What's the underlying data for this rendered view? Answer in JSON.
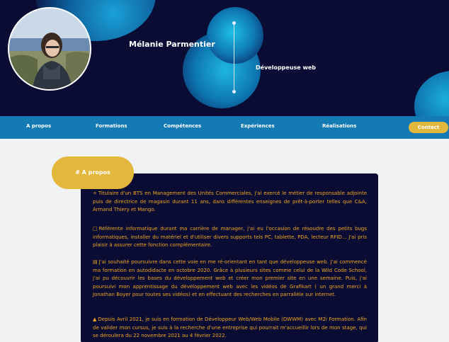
{
  "header": {
    "name": "Mélanie Parmentier",
    "role": "Développeuse web"
  },
  "nav": {
    "items": [
      "A propos",
      "Formations",
      "Compétences",
      "Expériences",
      "Réalisations"
    ],
    "contact": "Contact"
  },
  "about": {
    "heading": "# A propos",
    "paragraphs": [
      {
        "icon": "award-icon",
        "text": "Titulaire d'un BTS en Management des Unités Commerciales, j'ai exercé le métier de responsable adjointe puis de directrice de magasin durant 11 ans, dans différentes enseignes de prêt-à-porter telles que C&A, Armand Thiery et Mango."
      },
      {
        "icon": "laptop-icon",
        "text": "Référente informatique durant ma carrière de manager, j'ai eu l'occasion de résoudre des petits bugs informatiques, installer du matériel et d'utiliser divers supports tels PC, tablette, PDA, lecteur RFID... J'ai pris plaisir à assurer cette fonction complémentaire."
      },
      {
        "icon": "book-icon",
        "text": "J'ai souhaité poursuivre dans cette voie en me ré-orientant en tant que développeuse web. J'ai commencé ma formation en autodidacte en octobre 2020. Grâce à plusieurs sites comme celui de la Wild Code School, j'ai pu découvrir les bases du développement web et créer mon premier site en une semaine. Puis, j'ai poursuivi mon apprentissage du développement web avec les vidéos de Grafikart ( un grand merci à Jonathan Boyer pour toutes ses vidéos) et en effectuant des recherches en parrallèle sur internet."
      },
      {
        "icon": "graduation-icon",
        "text": "Depuis Avril 2021, je suis en formation de Développeur Web/Web Mobile (DWWM) avec M2i Formation. Afin de valider mon cursus, je suis à la recherche d'une entreprise qui pourrait m'accueillir lors de mon stage, qui se déroulera du 22 novembre 2021 au 4 février 2022."
      }
    ]
  },
  "colors": {
    "header_bg": "#0b0c33",
    "nav_bg": "#137ab3",
    "accent": "#e3b63c",
    "text_accent": "#f0a623",
    "page_bg": "#f1f2f3"
  }
}
